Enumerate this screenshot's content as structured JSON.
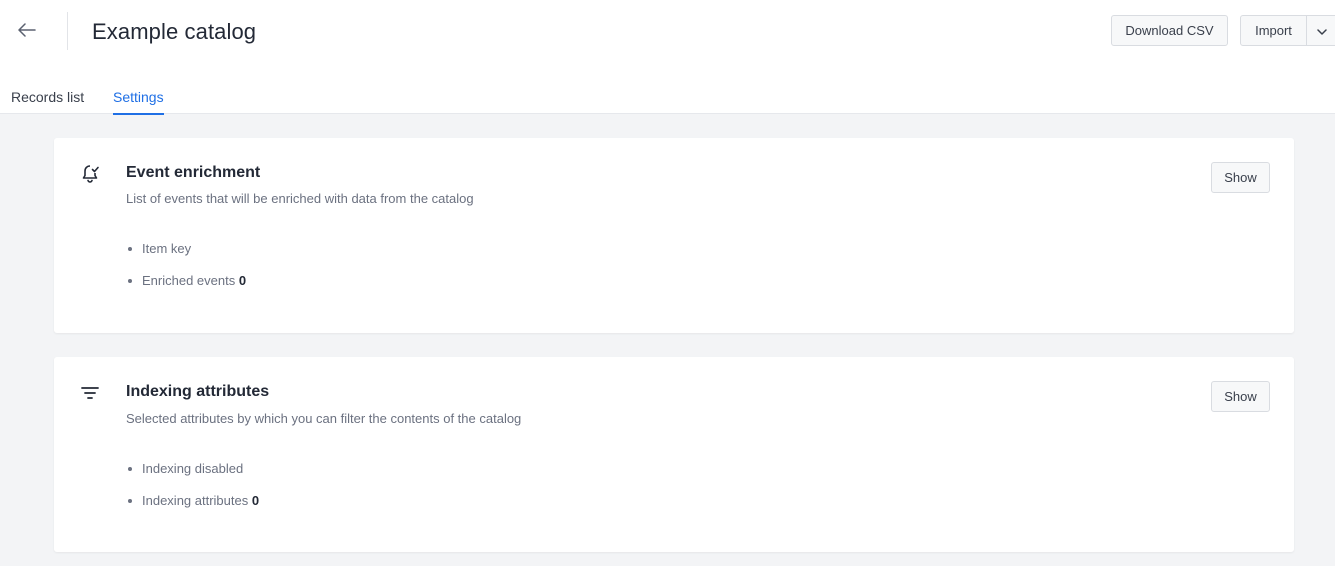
{
  "header": {
    "title": "Example catalog",
    "download_label": "Download CSV",
    "import_label": "Import"
  },
  "tabs": [
    {
      "label": "Records list",
      "active": false
    },
    {
      "label": "Settings",
      "active": true
    }
  ],
  "cards": [
    {
      "icon": "bell-check-icon",
      "title": "Event enrichment",
      "description": "List of events that will be enriched with data from the catalog",
      "show_label": "Show",
      "items": [
        {
          "label": "Item key",
          "value": ""
        },
        {
          "label": "Enriched events",
          "value": "0"
        }
      ]
    },
    {
      "icon": "filter-icon",
      "title": "Indexing attributes",
      "description": "Selected attributes by which you can filter the contents of the catalog",
      "show_label": "Show",
      "items": [
        {
          "label": "Indexing disabled",
          "value": ""
        },
        {
          "label": "Indexing attributes",
          "value": "0"
        }
      ]
    }
  ],
  "colors": {
    "accent": "#1f6fe5",
    "background": "#f3f4f6",
    "text": "#232936",
    "muted": "#6b7180"
  }
}
